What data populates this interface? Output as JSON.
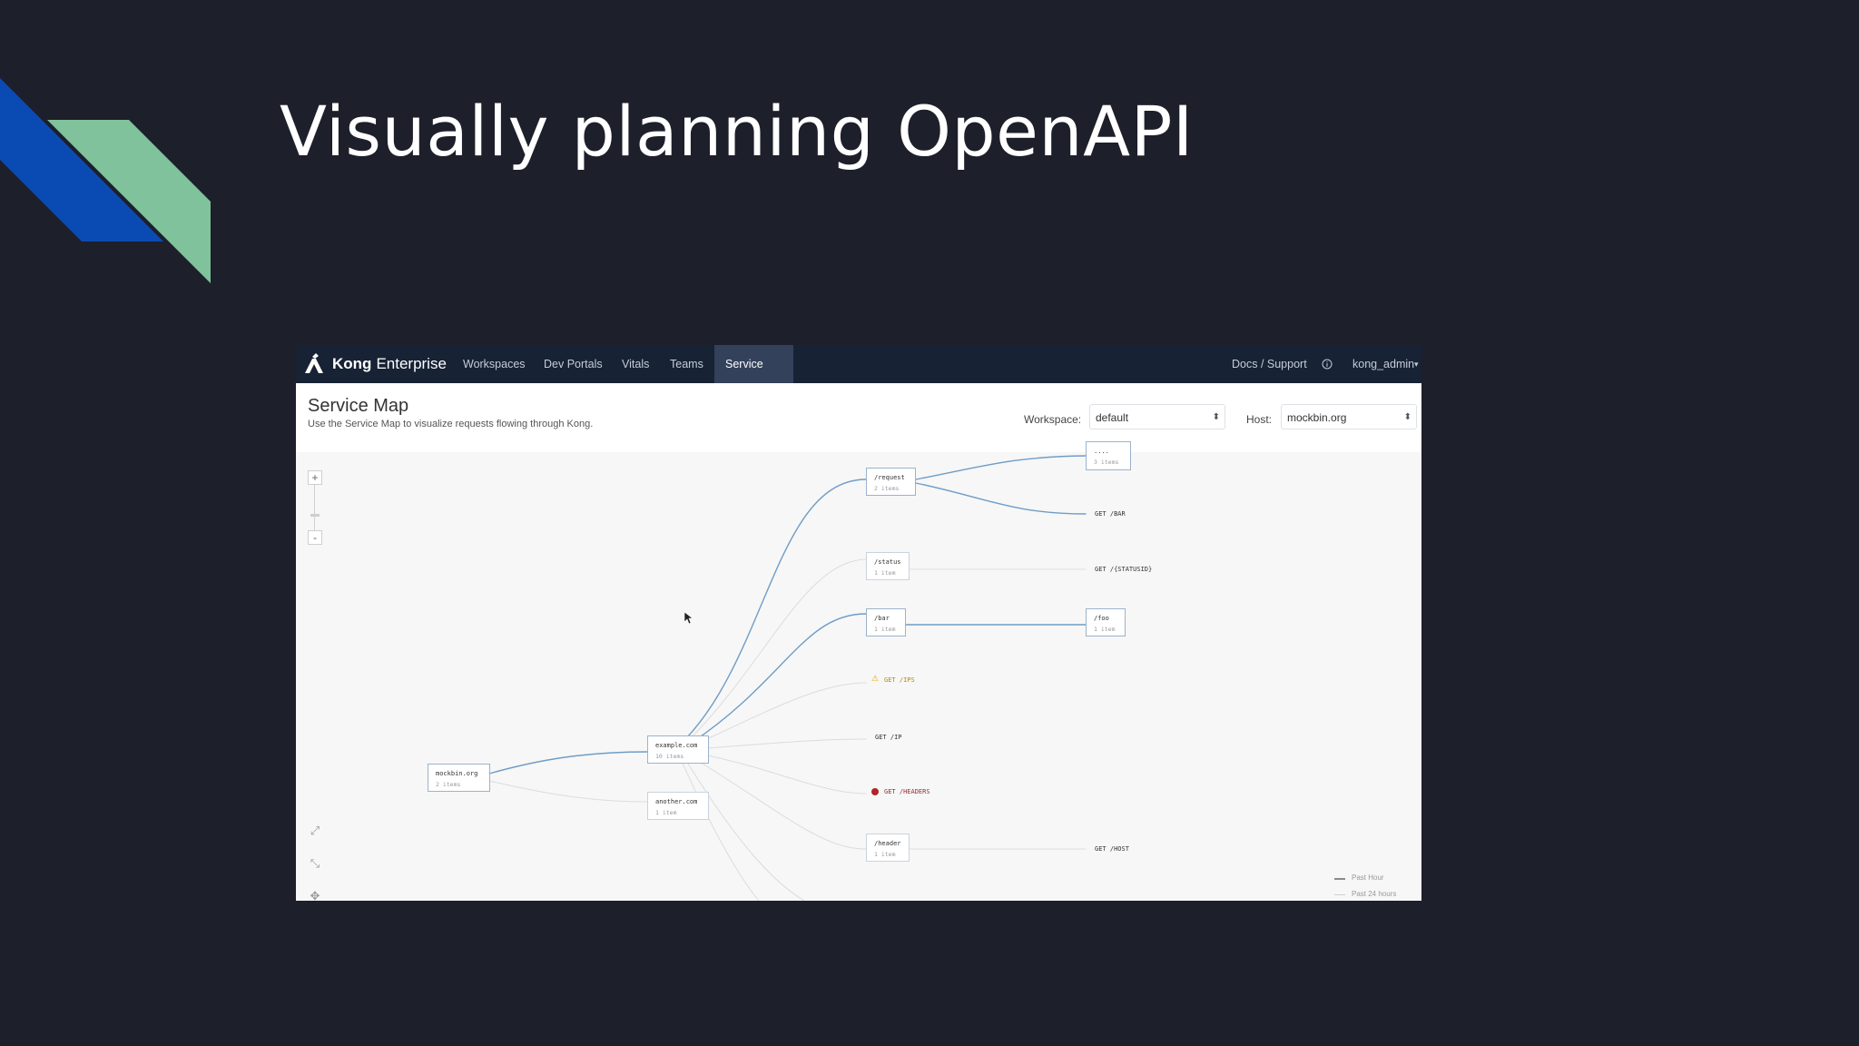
{
  "slide": {
    "title": "Visually planning OpenAPI"
  },
  "colors": {
    "background": "#1d1f2b",
    "deco_blue": "#0a4bb3",
    "deco_green": "#7fc29b",
    "nav_bg": "#172235",
    "edge": "#6f9dc6"
  },
  "screenshot": {
    "brand": {
      "bold": "Kong",
      "rest": "Enterprise",
      "icon": "kong-logo-icon"
    },
    "nav": [
      {
        "label": "Workspaces"
      },
      {
        "label": "Dev Portals"
      },
      {
        "label": "Vitals"
      },
      {
        "label": "Teams"
      },
      {
        "label": "Service Map",
        "active": true
      }
    ],
    "right_nav": {
      "docs": "Docs / Support",
      "info_icon": "info-icon",
      "user": "kong_admin"
    },
    "page": {
      "title": "Service Map",
      "subtitle": "Use the Service Map to visualize requests flowing through Kong."
    },
    "filters": {
      "workspace_label": "Workspace:",
      "workspace_value": "default",
      "host_label": "Host:",
      "host_value": "mockbin.org"
    },
    "zoom": {
      "in": "+",
      "out": "-"
    },
    "nodes": {
      "mockbin": {
        "name": "mockbin.org",
        "count": "2 items"
      },
      "example": {
        "name": "example.com",
        "count": "10 items"
      },
      "another": {
        "name": "another.com",
        "count": "1 item"
      },
      "request": {
        "name": "/request",
        "count": "2 items"
      },
      "top": {
        "name": "....",
        "count": "3 items"
      },
      "status": {
        "name": "/status",
        "count": "1 item"
      },
      "bar": {
        "name": "/bar",
        "count": "1 item"
      },
      "foo": {
        "name": "/foo",
        "count": "1 item"
      },
      "header": {
        "name": "/header",
        "count": "1 item"
      }
    },
    "leaves": {
      "get_bar": "GET /BAR",
      "get_statusid": "GET /{STATUSID}",
      "get_ips": "GET /IPS",
      "get_ip": "GET /IP",
      "get_headers": "GET /HEADERS",
      "get_host": "GET /HOST"
    },
    "legend": {
      "past_hour": "Past Hour",
      "past_24": "Past 24 hours"
    }
  }
}
